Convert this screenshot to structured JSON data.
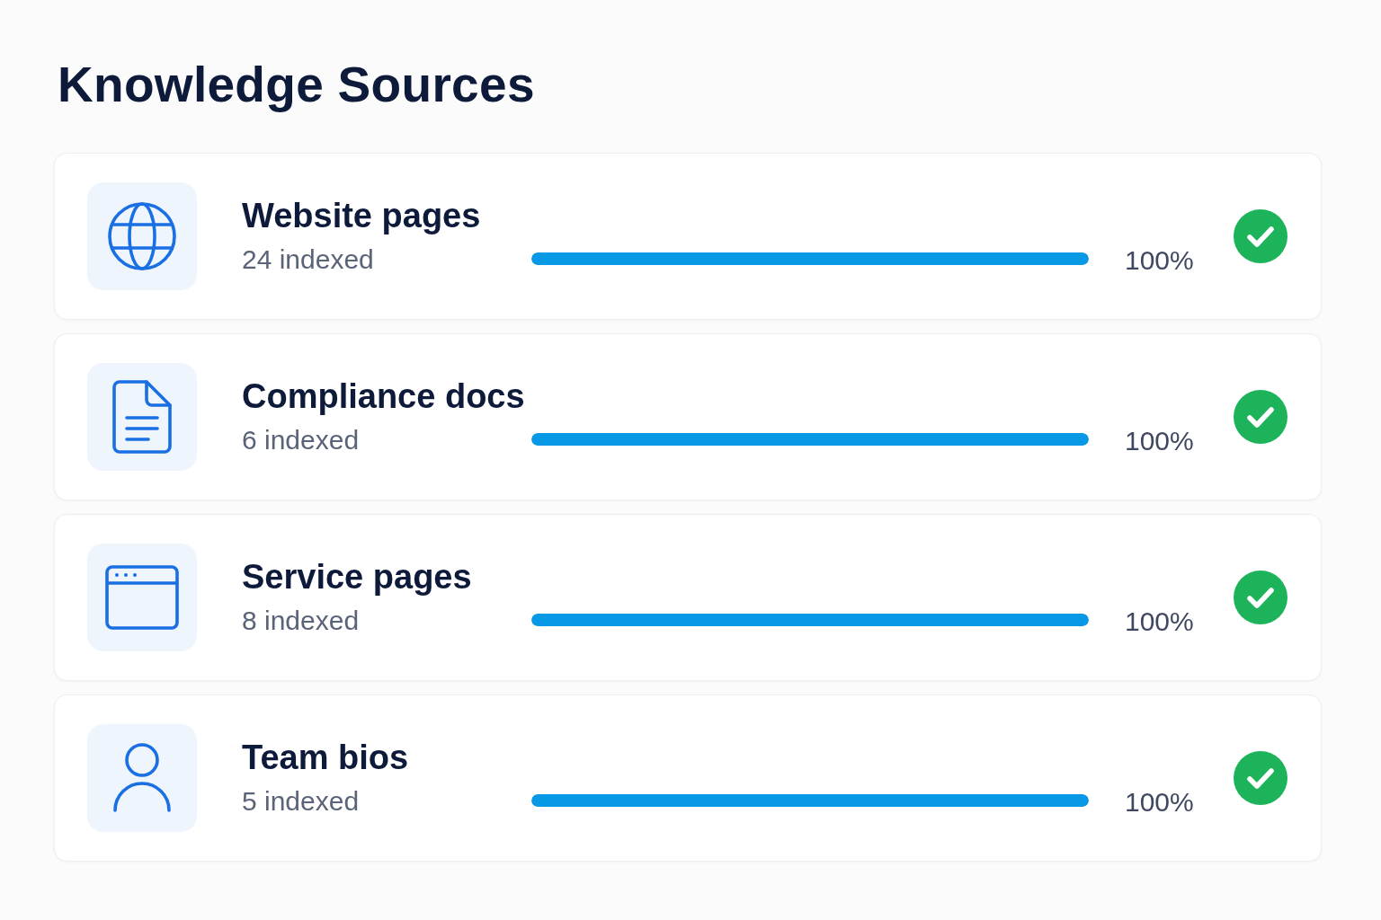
{
  "title": "Knowledge Sources",
  "sources": [
    {
      "kind": "web",
      "name": "Website pages",
      "count": "24 indexed",
      "level": 1,
      "reading": "100%",
      "complete": true
    },
    {
      "kind": "doc",
      "name": "Compliance docs",
      "count": "6 indexed",
      "level": 1,
      "reading": "100%",
      "complete": true
    },
    {
      "kind": "window",
      "name": "Service pages",
      "count": "8 indexed",
      "level": 1,
      "reading": "100%",
      "complete": true
    },
    {
      "kind": "person",
      "name": "Team bios",
      "count": "5 indexed",
      "level": 1,
      "reading": "100%",
      "complete": true
    }
  ]
}
